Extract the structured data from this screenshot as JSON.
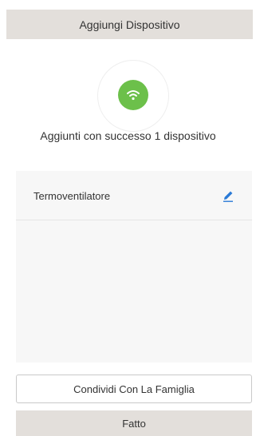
{
  "header": {
    "title": "Aggiungi Dispositivo"
  },
  "status": {
    "icon": "wifi-icon",
    "message": "Aggiunti con successo 1 dispositivo"
  },
  "devices": [
    {
      "name": "Termoventilatore",
      "edit_icon": "pencil-icon"
    }
  ],
  "actions": {
    "share_label": "Condividi Con La Famiglia",
    "done_label": "Fatto"
  },
  "colors": {
    "success_green": "#6cc04a",
    "accent_blue": "#2a7ad6",
    "header_bg": "#e3dfdb"
  }
}
